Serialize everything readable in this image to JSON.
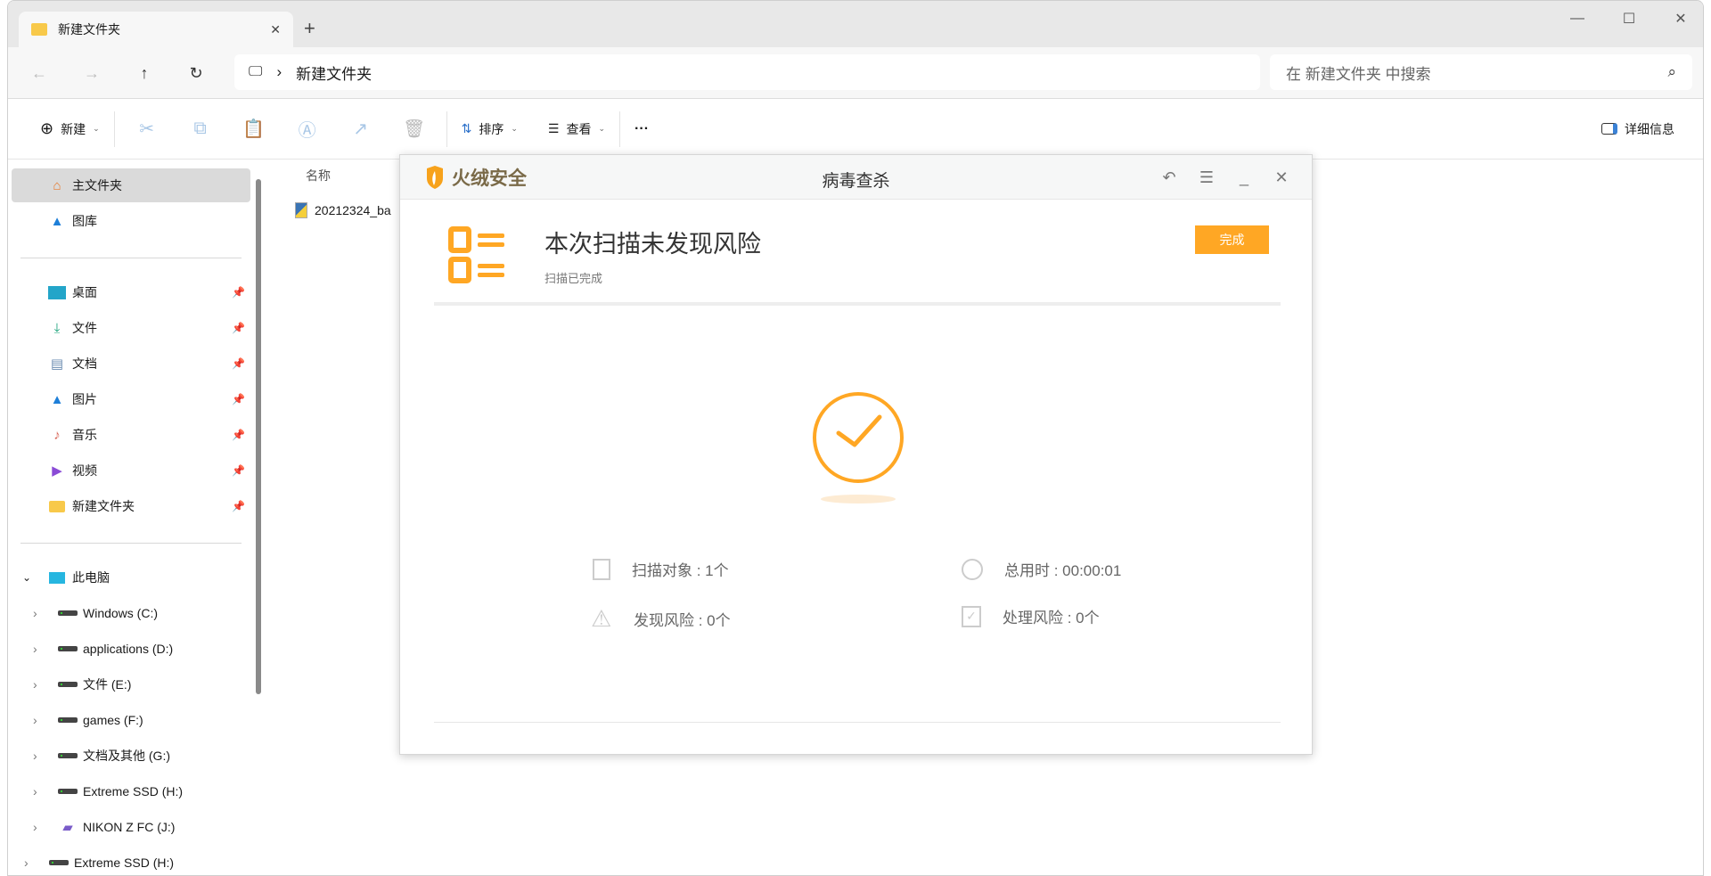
{
  "explorer": {
    "tab_title": "新建文件夹",
    "new_tab": "+",
    "breadcrumb": "新建文件夹",
    "search_placeholder": "在 新建文件夹 中搜索",
    "toolbar": {
      "new": "新建",
      "sort": "排序",
      "view": "查看",
      "more": "···",
      "details": "详细信息"
    },
    "sidebar": {
      "top": [
        {
          "label": "主文件夹"
        },
        {
          "label": "图库"
        }
      ],
      "pinned": [
        {
          "label": "桌面"
        },
        {
          "label": "文件"
        },
        {
          "label": "文档"
        },
        {
          "label": "图片"
        },
        {
          "label": "音乐"
        },
        {
          "label": "视频"
        },
        {
          "label": "新建文件夹"
        }
      ],
      "this_pc": "此电脑",
      "drives": [
        {
          "label": "Windows (C:)"
        },
        {
          "label": "applications (D:)"
        },
        {
          "label": "文件 (E:)"
        },
        {
          "label": "games (F:)"
        },
        {
          "label": "文档及其他 (G:)"
        },
        {
          "label": "Extreme SSD (H:)"
        },
        {
          "label": "NIKON Z FC  (J:)"
        }
      ],
      "extra": "Extreme SSD (H:)"
    },
    "column_name": "名称",
    "files": [
      {
        "name": "20212324_ba"
      }
    ]
  },
  "dialog": {
    "brand": "火绒安全",
    "title": "病毒查杀",
    "headline": "本次扫描未发现风险",
    "subline": "扫描已完成",
    "done_button": "完成",
    "stats": {
      "scanned": "扫描对象 : 1个",
      "elapsed": "总用时 : 00:00:01",
      "found": "发现风险 : 0个",
      "handled": "处理风险 : 0个"
    },
    "accent": "#ffa724"
  }
}
